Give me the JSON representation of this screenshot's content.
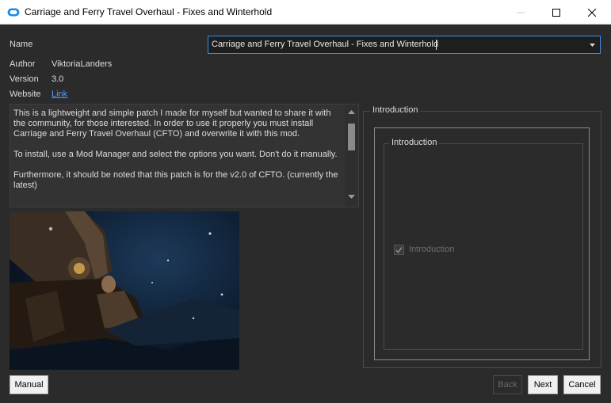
{
  "window": {
    "title": "Carriage and Ferry Travel Overhaul - Fixes and Winterhold",
    "icon": "mod-organizer-icon"
  },
  "fields": {
    "name_label": "Name",
    "name_value": "Carriage and Ferry Travel Overhaul - Fixes and Winterhold",
    "author_label": "Author",
    "author_value": "ViktoriaLanders",
    "version_label": "Version",
    "version_value": "3.0",
    "website_label": "Website",
    "website_link": "Link"
  },
  "description": {
    "paragraphs": [
      "This is a lightweight and simple patch I made for myself but wanted to share it with the community, for those interested. In order to use it properly you must install Carriage and Ferry Travel Overhaul (CFTO) and overwrite it with this mod.",
      "To install, use a Mod Manager and select the options you want. Don't do it manually.",
      "Furthermore, it should be noted that this patch is for the v2.0 of CFTO. (currently the latest)"
    ]
  },
  "options_panel": {
    "group_title": "Introduction",
    "inner_group_title": "Introduction",
    "checkbox_label": "Introduction",
    "checkbox_checked": true,
    "checkbox_disabled": true
  },
  "buttons": {
    "manual": "Manual",
    "back": "Back",
    "next": "Next",
    "cancel": "Cancel"
  },
  "colors": {
    "background": "#2b2b2b",
    "accent": "#3d8ee6",
    "link": "#4ea1ff"
  }
}
